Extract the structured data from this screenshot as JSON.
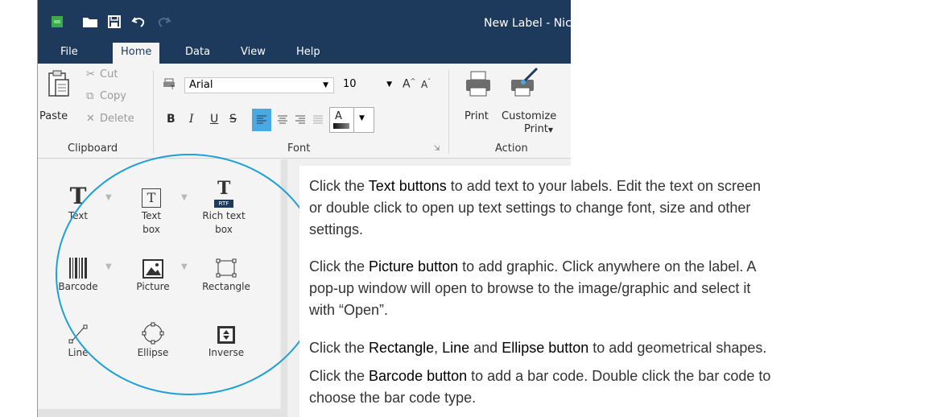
{
  "window": {
    "title": "New Label - Nic"
  },
  "colors": {
    "titlebar": "#1d3a5c",
    "accent_circle": "#1ea0d6",
    "selected_button": "#4aa9e3"
  },
  "quick_access": [
    "app-logo-icon",
    "folder-icon",
    "save-icon",
    "undo-icon",
    "redo-icon"
  ],
  "menu": {
    "tabs": [
      "File",
      "Home",
      "Data",
      "View",
      "Help"
    ],
    "active": "Home"
  },
  "ribbon": {
    "clipboard": {
      "paste": "Paste",
      "cut": "Cut",
      "copy": "Copy",
      "delete": "Delete",
      "label": "Clipboard"
    },
    "font": {
      "family": "Arial",
      "size": "10",
      "grow": "A",
      "shrink": "A",
      "bold": "B",
      "italic": "I",
      "underline": "U",
      "strike": "S",
      "font_color": "A",
      "label": "Font"
    },
    "action": {
      "print": "Print",
      "customize_line1": "Customize",
      "customize_line2": "Print",
      "label": "Action"
    }
  },
  "tools": {
    "text": "Text",
    "textbox_line1": "Text",
    "textbox_line2": "box",
    "richtext_line1": "Rich text",
    "richtext_line2": "box",
    "barcode": "Barcode",
    "picture": "Picture",
    "rectangle": "Rectangle",
    "line": "Line",
    "ellipse": "Ellipse",
    "inverse": "Inverse",
    "text_icon_glyph": "T",
    "textbox_icon_glyph": "T",
    "richtext_icon_glyph": "T",
    "rtf_badge": "RTF"
  },
  "instructions": {
    "p1_pre": "Click the ",
    "p1_bold": "Text buttons",
    "p1_post": " to add text to your labels. Edit the text on screen or double click to open up text settings to change font, size and other settings.",
    "p2_pre": "Click the ",
    "p2_bold": "Picture button",
    "p2_post": " to add graphic. Click anywhere on the label. A pop-up window will open to browse to the image/graphic and select it with “Open”.",
    "p3_pre": "Click the ",
    "p3_bold1": "Rectangle",
    "p3_sep1": ", ",
    "p3_bold2": "Line",
    "p3_sep2": " and ",
    "p3_bold3": "Ellipse button",
    "p3_post": " to add geometrical shapes.",
    "p4_pre": "Click the ",
    "p4_bold": "Barcode button",
    "p4_post": " to add a bar code. Double click the bar code to choose the bar code type."
  }
}
